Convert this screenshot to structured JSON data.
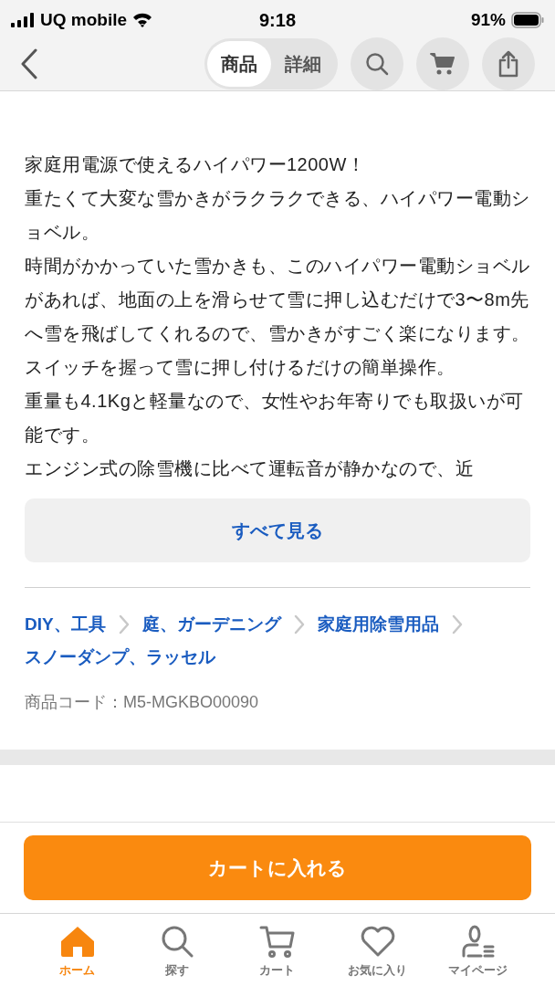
{
  "status_bar": {
    "carrier": "UQ mobile",
    "time": "9:18",
    "battery": "91%"
  },
  "header": {
    "segments": [
      {
        "label": "商品",
        "selected": true
      },
      {
        "label": "詳細",
        "selected": false
      }
    ]
  },
  "description": {
    "paragraphs": [
      "家庭用電源で使えるハイパワー1200W！",
      "重たくて大変な雪かきがラクラクできる、ハイパワー電動ショベル。",
      "時間がかかっていた雪かきも、このハイパワー電動ショベルがあれば、地面の上を滑らせて雪に押し込むだけで3〜8m先へ雪を飛ばしてくれるので、雪かきがすごく楽になります。",
      "スイッチを握って雪に押し付けるだけの簡単操作。",
      "重量も4.1Kgと軽量なので、女性やお年寄りでも取扱いが可能です。",
      "エンジン式の除雪機に比べて運転音が静かなので、近"
    ],
    "see_all": "すべて見る"
  },
  "breadcrumbs": [
    "DIY、工具",
    "庭、ガーデニング",
    "家庭用除雪用品",
    "スノーダンプ、ラッセル"
  ],
  "product_code": "商品コード：M5-MGKBO00090",
  "add_to_cart": "カートに入れる",
  "tab_bar": [
    {
      "label": "ホーム",
      "selected": true,
      "kind": "home"
    },
    {
      "label": "探す",
      "selected": false,
      "kind": "search"
    },
    {
      "label": "カート",
      "selected": false,
      "kind": "cart"
    },
    {
      "label": "お気に入り",
      "selected": false,
      "kind": "heart"
    },
    {
      "label": "マイページ",
      "selected": false,
      "kind": "user"
    }
  ]
}
